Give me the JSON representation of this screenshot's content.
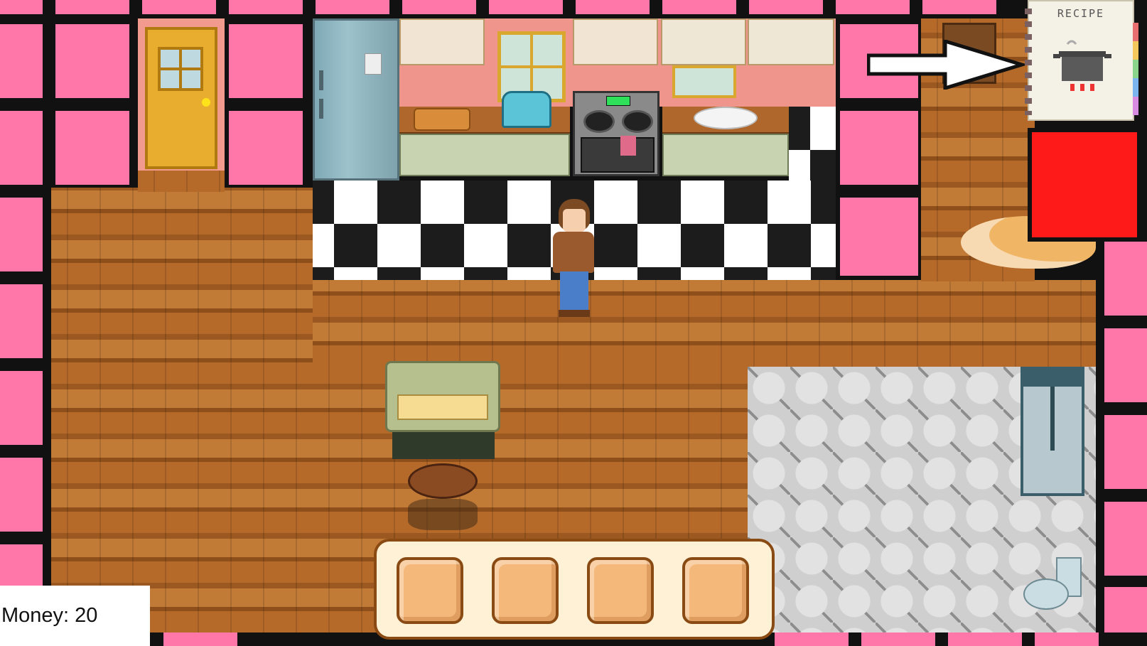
{
  "hud": {
    "money_label": "Money: 20"
  },
  "recipe_book": {
    "title": "RECIPE",
    "icon": "cooking-pot-icon"
  },
  "hint_arrow": {
    "icon": "arrow-right-icon"
  },
  "inventory": {
    "slot_count": 4,
    "slots": [
      "",
      "",
      "",
      ""
    ]
  },
  "colors": {
    "wall_pink": "#ff77a8",
    "alert_red": "#ff1a1a",
    "inventory_frame": "#fff1d6"
  }
}
